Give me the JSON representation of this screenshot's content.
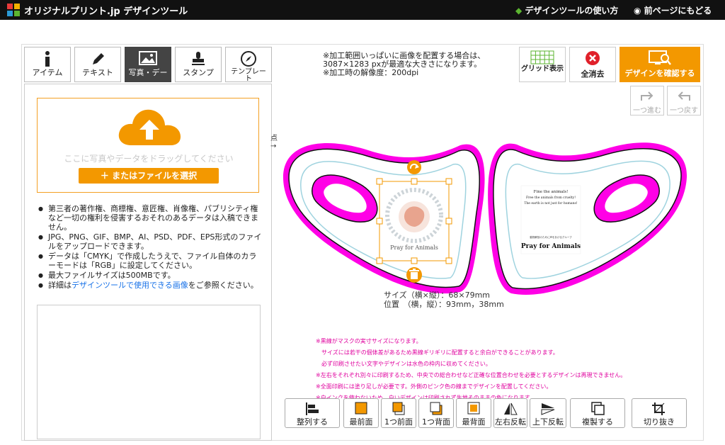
{
  "header": {
    "site_title": "オリジナルプリント.jp デザインツール",
    "help_link": "デザインツールの使い方",
    "back_link": "前ページにもどる"
  },
  "tabs": [
    {
      "label": "アイテム",
      "icon": "info-icon"
    },
    {
      "label": "テキスト",
      "icon": "pen-icon"
    },
    {
      "label": "写真・デー",
      "icon": "image-icon",
      "active": true
    },
    {
      "label": "スタンプ",
      "icon": "stamp-icon"
    },
    {
      "label": "テンプレー\nト",
      "icon": "compass-icon"
    }
  ],
  "upload": {
    "drop_text": "ここに写真やデータをドラッグしてください",
    "file_button": "＋ またはファイルを選択"
  },
  "notes": [
    "第三者の著作権、商標権、意匠権、肖像権、パブリシティ権など一切の権利を侵害するおそれのあるデータは入稿できません。",
    "JPG、PNG、GIF、BMP、AI、PSD、PDF、EPS形式のファイルをアップロードできます。",
    "データは「CMYK」で作成したうえで、ファイル自体のカラーモードは「RGB」に設定してください。",
    "最大ファイルサイズは500MBです。"
  ],
  "notes_last": {
    "prefix": "詳細は",
    "link": "デザインツールで使用できる画像",
    "suffix": "をご参照ください。"
  },
  "info": {
    "line1": "※加工範囲いっぱいに画像を配置する場合は、",
    "line2": "3087×1283 pxが最適な大きさになります。",
    "line3": "※加工時の解像度：200dpi"
  },
  "top_buttons": {
    "grid": "グリッド表示",
    "clear_all": "全消去",
    "confirm": "デザインを確認する"
  },
  "undo_buttons": {
    "redo": "一つ進む",
    "undo": "一つ戻す"
  },
  "canvas": {
    "point_label": "点\n→",
    "right_text_1": "Fine the animals!",
    "right_text_2": "Free the animals from cruelty!",
    "right_text_3": "The earth is not just for humans!",
    "right_text_4": "動物解放のために声をあげるグループ",
    "right_brand": "Pray for Animals",
    "left_brand": "Pray for Animals"
  },
  "dims": {
    "size": "サイズ（横×縦）：68×79mm",
    "position": "位置　（横，縦）：93mm，38mm"
  },
  "warnings": [
    "※黒線がマスクの実寸サイズになります。",
    "　サイズには若干の個体差があるため黒線ギリギリに配置すると余白ができることがあります。",
    "　必ず印刷させたい文字やデザインは水色の枠内に収めてください。",
    "※左右をそれぞれ別々に印刷するため、中央での総合わせなど正確な位置合わせを必要とするデザインは再現できません。",
    "※全面印刷には塗り足しが必要です。外側のピンク色の線までデザインを配置してください。",
    "※白インクを使わないため、白いデザインは印刷されず生地そのままの色になります。"
  ],
  "tools": [
    {
      "label": "整列する",
      "icon": "align-icon"
    },
    {
      "label": "最前面",
      "icon": "front-most-icon"
    },
    {
      "label": "1つ前面",
      "icon": "forward-icon"
    },
    {
      "label": "1つ背面",
      "icon": "backward-icon"
    },
    {
      "label": "最背面",
      "icon": "back-most-icon"
    },
    {
      "label": "左右反転",
      "icon": "flip-horizontal-icon"
    },
    {
      "label": "上下反転",
      "icon": "flip-vertical-icon"
    },
    {
      "label": "複製する",
      "icon": "duplicate-icon"
    },
    {
      "label": "切り抜き",
      "icon": "crop-icon"
    }
  ],
  "colors": {
    "accent": "#f39800",
    "magenta": "#ff00e6",
    "cyan": "#9fd3df",
    "danger": "#e0202a"
  }
}
